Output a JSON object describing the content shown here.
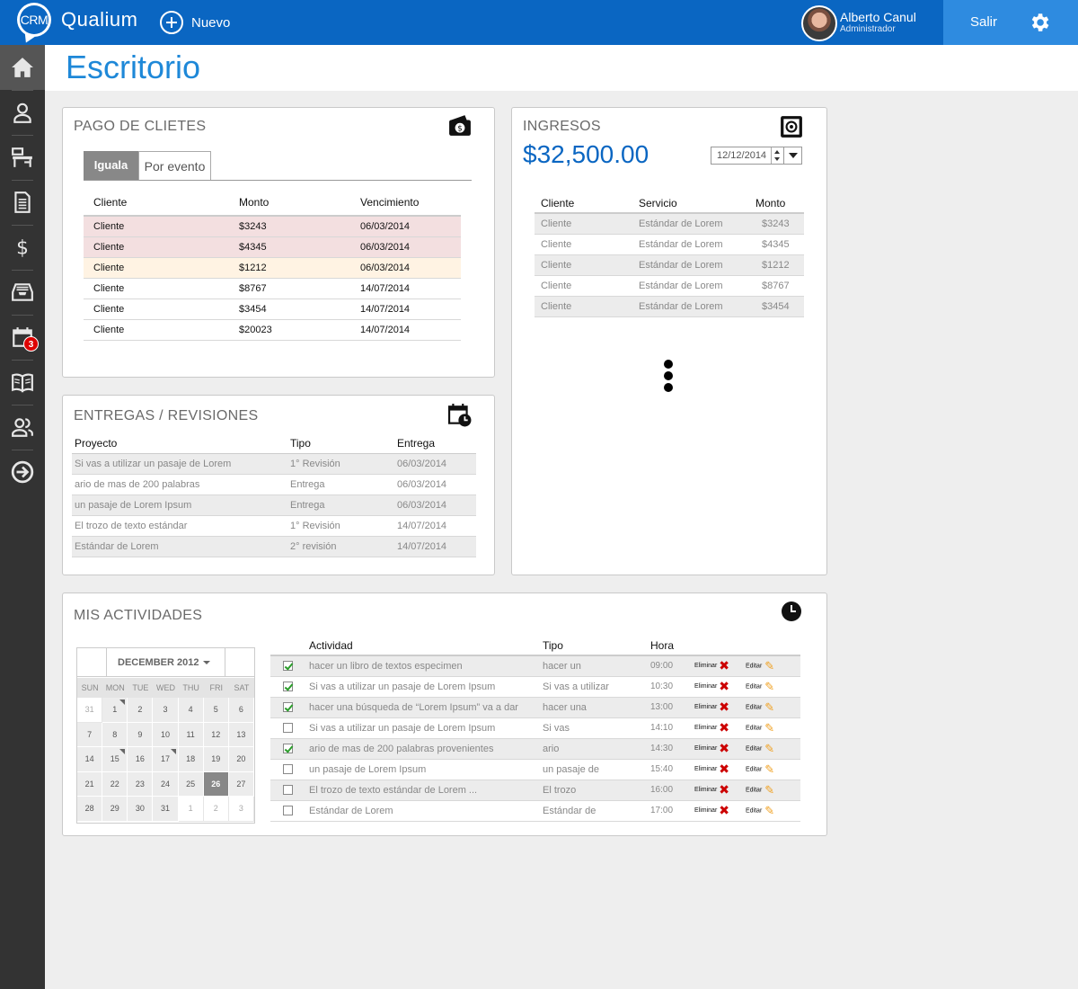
{
  "header": {
    "logo_text": "CRM",
    "brand": "Qualium",
    "new_label": "Nuevo",
    "user_name": "Alberto Canul",
    "user_role": "Administrador",
    "logout_label": "Salir"
  },
  "sidebar": {
    "items": [
      {
        "name": "home-icon"
      },
      {
        "name": "user-icon"
      },
      {
        "name": "desk-icon"
      },
      {
        "name": "document-icon"
      },
      {
        "name": "dollar-icon"
      },
      {
        "name": "inbox-icon"
      },
      {
        "name": "calendar-icon",
        "badge": "3"
      },
      {
        "name": "book-icon"
      },
      {
        "name": "users-icon"
      },
      {
        "name": "logout-arrow-icon"
      }
    ]
  },
  "page": {
    "title": "Escritorio"
  },
  "pago": {
    "title": "PAGO DE CLIETES",
    "tabs": [
      "Iguala",
      "Por evento"
    ],
    "columns": [
      "Cliente",
      "Monto",
      "Vencimiento"
    ],
    "rows": [
      [
        "Cliente",
        "$3243",
        "06/03/2014"
      ],
      [
        "Cliente",
        "$4345",
        "06/03/2014"
      ],
      [
        "Cliente",
        "$1212",
        "06/03/2014"
      ],
      [
        "Cliente",
        "$8767",
        "14/07/2014"
      ],
      [
        "Cliente",
        "$3454",
        "14/07/2014"
      ],
      [
        "Cliente",
        "$20023",
        "14/07/2014"
      ]
    ]
  },
  "ingresos": {
    "title": "INGRESOS",
    "total": "$32,500.00",
    "date": "12/12/2014",
    "columns": [
      "Cliente",
      "Servicio",
      "Monto"
    ],
    "rows": [
      [
        "Cliente",
        "Estándar de Lorem",
        "$3243"
      ],
      [
        "Cliente",
        "Estándar de Lorem",
        "$4345"
      ],
      [
        "Cliente",
        "Estándar de Lorem",
        "$1212"
      ],
      [
        "Cliente",
        "Estándar de Lorem",
        "$8767"
      ],
      [
        "Cliente",
        "Estándar de Lorem",
        "$3454"
      ]
    ]
  },
  "entregas": {
    "title": "ENTREGAS / REVISIONES",
    "columns": [
      "Proyecto",
      "Tipo",
      "Entrega"
    ],
    "rows": [
      [
        "Si vas a utilizar un pasaje de Lorem",
        "1° Revisión",
        "06/03/2014"
      ],
      [
        "ario de mas de 200 palabras",
        "Entrega",
        "06/03/2014"
      ],
      [
        "un pasaje de Lorem Ipsum",
        "Entrega",
        "06/03/2014"
      ],
      [
        "El trozo de texto estándar",
        "1° Revisión",
        "14/07/2014"
      ],
      [
        "Estándar de Lorem",
        "2° revisión",
        "14/07/2014"
      ]
    ]
  },
  "actividades": {
    "title": "MIS ACTIVIDADES",
    "calendar": {
      "month": "DECEMBER 2012",
      "days_of_week": [
        "SUN",
        "MON",
        "TUE",
        "WED",
        "THU",
        "FRI",
        "SAT"
      ],
      "weeks": [
        [
          "31",
          "1",
          "2",
          "3",
          "4",
          "5",
          "6"
        ],
        [
          "7",
          "8",
          "9",
          "10",
          "11",
          "12",
          "13"
        ],
        [
          "14",
          "15",
          "16",
          "17",
          "18",
          "19",
          "20"
        ],
        [
          "21",
          "22",
          "23",
          "24",
          "25",
          "26",
          "27"
        ],
        [
          "28",
          "29",
          "30",
          "31",
          "1",
          "2",
          "3"
        ]
      ],
      "selected": "26"
    },
    "columns": [
      "Actividad",
      "Tipo",
      "Hora"
    ],
    "delete_label": "Eliminar",
    "edit_label": "Editar",
    "rows": [
      {
        "done": true,
        "activity": "hacer un libro de textos especimen",
        "type": "hacer un",
        "time": "09:00"
      },
      {
        "done": true,
        "activity": "Si vas a utilizar un pasaje de Lorem Ipsum",
        "type": "Si vas a utilizar",
        "time": "10:30"
      },
      {
        "done": true,
        "activity": "hacer una búsqueda de “Lorem Ipsum” va a dar",
        "type": "hacer una",
        "time": "13:00"
      },
      {
        "done": false,
        "activity": "Si vas a utilizar un pasaje de Lorem Ipsum",
        "type": "Si vas",
        "time": "14:10"
      },
      {
        "done": true,
        "activity": "ario de mas de 200 palabras provenientes",
        "type": "ario",
        "time": "14:30"
      },
      {
        "done": false,
        "activity": "un pasaje de Lorem Ipsum",
        "type": "un pasaje de",
        "time": "15:40"
      },
      {
        "done": false,
        "activity": "El trozo de texto estándar de Lorem ...",
        "type": "El trozo",
        "time": "16:00"
      },
      {
        "done": false,
        "activity": "Estándar de Lorem",
        "type": "Estándar de",
        "time": "17:00"
      }
    ]
  },
  "colors": {
    "primary": "#0a66c2",
    "title": "#1e88d8",
    "sidebar": "#333333",
    "badge": "#dd0000"
  }
}
